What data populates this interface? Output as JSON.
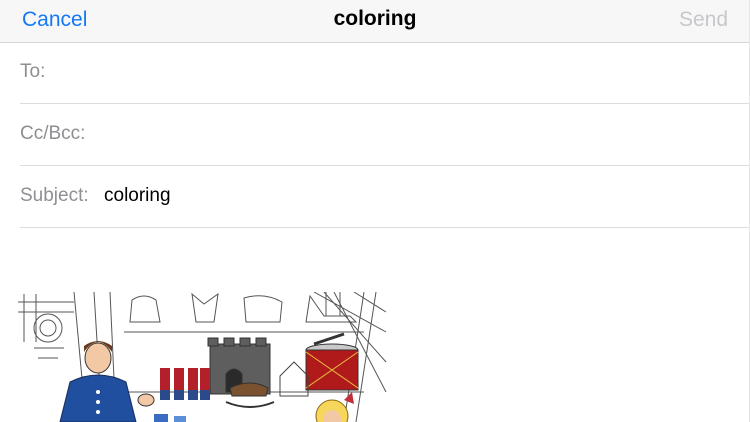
{
  "navbar": {
    "cancel_label": "Cancel",
    "title": "coloring",
    "send_label": "Send"
  },
  "fields": {
    "to_label": "To:",
    "to_value": "",
    "ccbcc_label": "Cc/Bcc:",
    "ccbcc_value": "",
    "subject_label": "Subject:",
    "subject_value": "coloring"
  },
  "attachment": {
    "icon": "coloring-page-image"
  },
  "colors": {
    "accent": "#1479f5",
    "disabled": "#c7c7cc",
    "label": "#8e8e93"
  }
}
